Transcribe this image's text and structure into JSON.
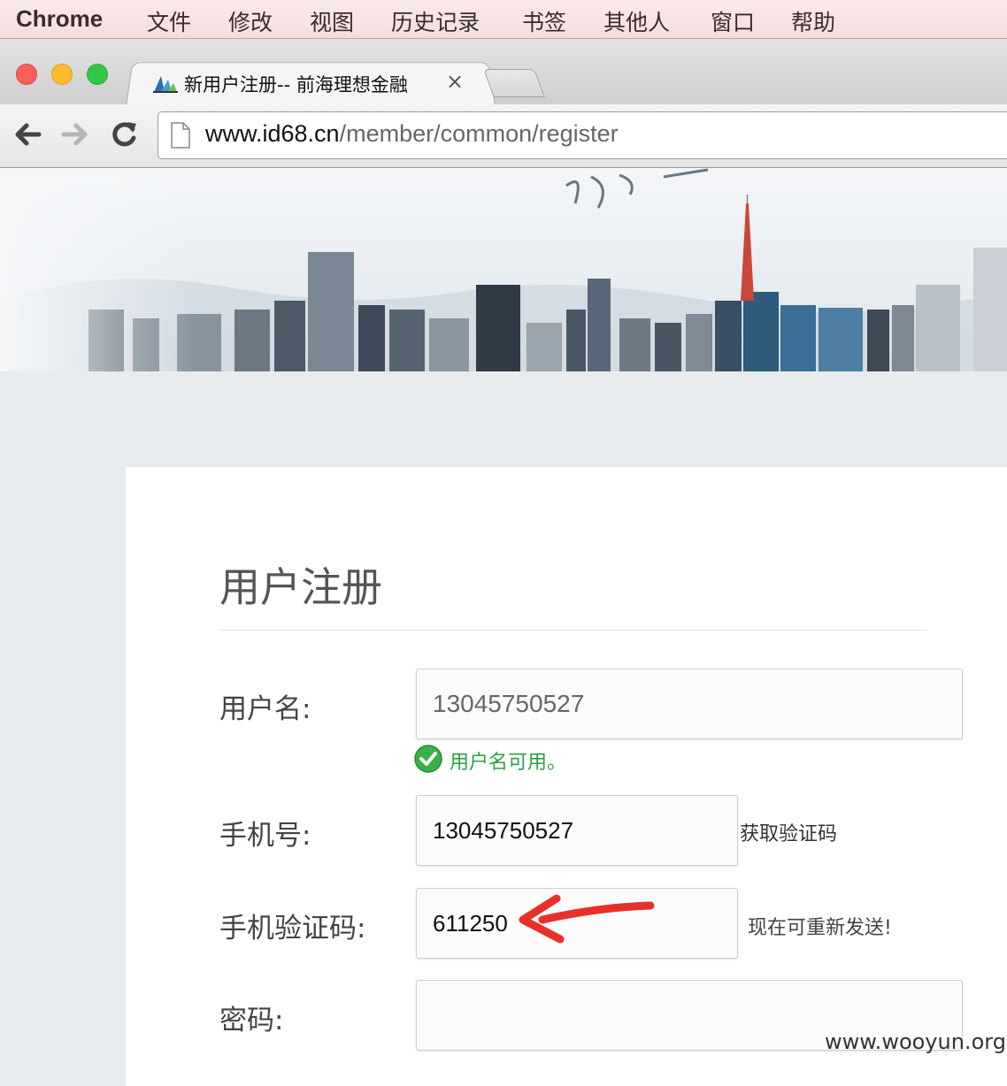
{
  "menubar": {
    "app_name": "Chrome",
    "items": [
      "文件",
      "修改",
      "视图",
      "历史记录",
      "书签",
      "其他人",
      "窗口",
      "帮助"
    ]
  },
  "browser": {
    "tab_title": "新用户注册-- 前海理想金融",
    "tab_close": "×",
    "url_host": "www.id68.cn",
    "url_path": "/member/common/register"
  },
  "form": {
    "title": "用户注册",
    "username": {
      "label": "用户名:",
      "value": "13045750527",
      "status": "用户名可用。"
    },
    "phone": {
      "label": "手机号:",
      "value": "13045750527",
      "get_code": "获取验证码"
    },
    "sms_code": {
      "label": "手机验证码:",
      "value": "611250",
      "resend_status": "现在可重新发送!"
    },
    "password": {
      "label": "密码:",
      "value": ""
    }
  },
  "watermark": "www.wooyun.org",
  "colors": {
    "valid_green": "#2aa13e",
    "arrow_red": "#e8302a",
    "traffic_red": "#fc5f57",
    "traffic_yellow": "#fdbc2e",
    "traffic_green": "#33c748"
  }
}
